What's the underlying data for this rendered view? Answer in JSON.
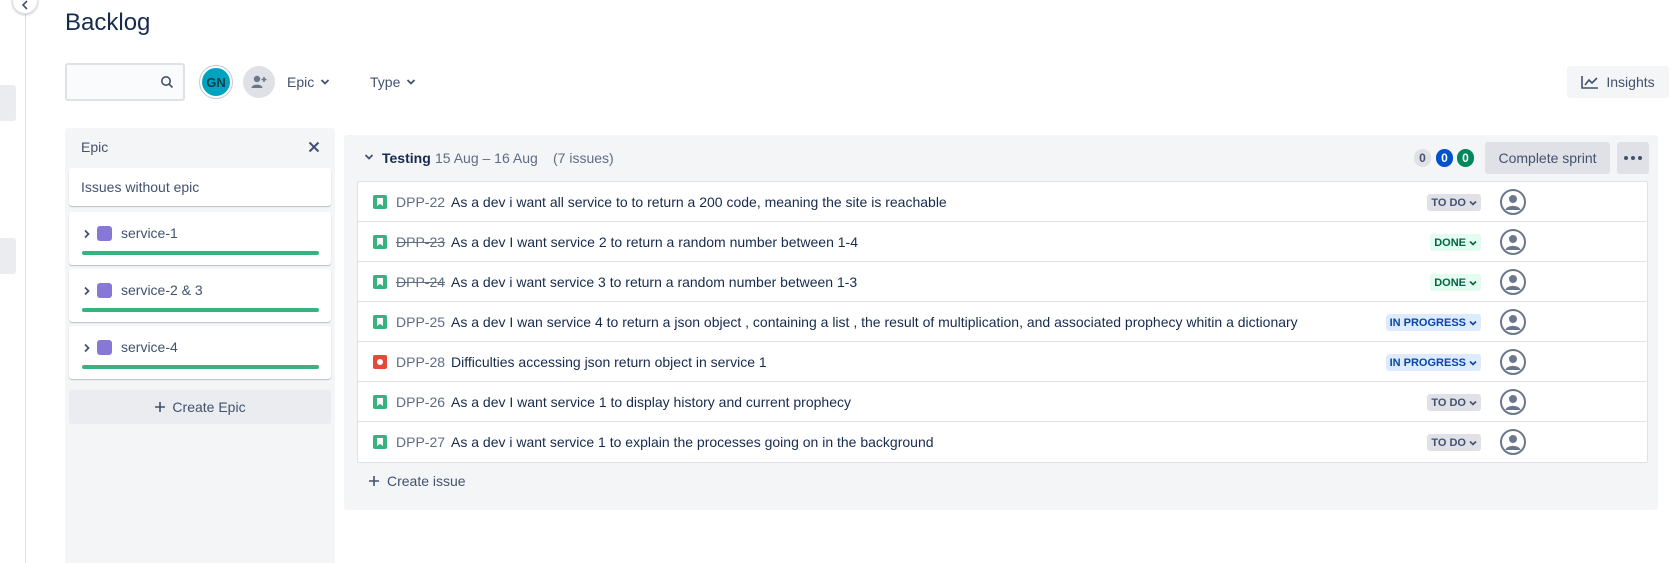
{
  "page": {
    "title": "Backlog"
  },
  "toolbar": {
    "search_placeholder": "",
    "avatar_initials": "GN",
    "filters": [
      {
        "label": "Epic"
      },
      {
        "label": "Type"
      }
    ],
    "insights_label": "Insights"
  },
  "epic_panel": {
    "title": "Epic",
    "no_epic_label": "Issues without epic",
    "epics": [
      {
        "name": "service-1",
        "color": "#8777d9",
        "progress": 1.0
      },
      {
        "name": "service-2 & 3",
        "color": "#8777d9",
        "progress": 1.0
      },
      {
        "name": "service-4",
        "color": "#8777d9",
        "progress": 1.0
      }
    ],
    "create_label": "Create Epic"
  },
  "sprint": {
    "name": "Testing",
    "dates": "15 Aug – 16 Aug",
    "issue_count": "(7 issues)",
    "counts": {
      "todo": "0",
      "in_progress": "0",
      "done": "0"
    },
    "complete_label": "Complete sprint",
    "create_issue_label": "Create issue",
    "issues": [
      {
        "type": "story",
        "key": "DPP-22",
        "summary": "As a dev i want all service to to return a 200 code, meaning the site is reachable",
        "status": "TO DO",
        "resolved": false
      },
      {
        "type": "story",
        "key": "DPP-23",
        "summary": "As a dev I want service 2 to return a random number between 1-4",
        "status": "DONE",
        "resolved": true
      },
      {
        "type": "story",
        "key": "DPP-24",
        "summary": "As a dev i want service 3 to return a random number between 1-3",
        "status": "DONE",
        "resolved": true
      },
      {
        "type": "story",
        "key": "DPP-25",
        "summary": "As a dev I wan service 4 to return a json object , containing a list , the result of multiplication, and associated prophecy whitin a dictionary",
        "status": "IN PROGRESS",
        "resolved": false
      },
      {
        "type": "bug",
        "key": "DPP-28",
        "summary": "Difficulties accessing json return object in service 1",
        "status": "IN PROGRESS",
        "resolved": false
      },
      {
        "type": "story",
        "key": "DPP-26",
        "summary": "As a dev I want service 1 to display history and current prophecy",
        "status": "TO DO",
        "resolved": false
      },
      {
        "type": "story",
        "key": "DPP-27",
        "summary": "As a dev i want service 1 to explain the processes going on in the background",
        "status": "TO DO",
        "resolved": false
      }
    ]
  },
  "colors": {
    "story": "#36b37e",
    "bug": "#e5493a",
    "accent": "#0052cc",
    "done": "#00875a"
  }
}
